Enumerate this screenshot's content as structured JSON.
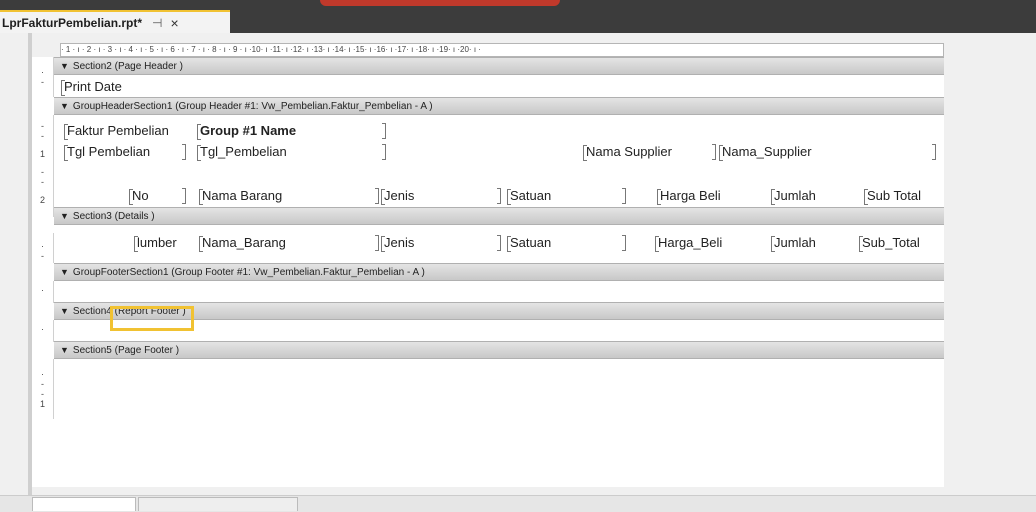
{
  "tab": {
    "title": "LprFakturPembelian.rpt*",
    "pin": "⊣",
    "close": "×"
  },
  "ruler": "· 1 · ı · 2 · ı · 3 · ı · 4 · ı · 5 · ı · 6 · ı · 7 · ı · 8 · ı · 9 · ı ·10· ı ·11· ı ·12· ı ·13· ı ·14· ı ·15· ı ·16· ı ·17· ı ·18· ı ·19· ı ·20· ı ·",
  "sections": {
    "page_header": "Section2 (Page Header )",
    "group_header": "GroupHeaderSection1 (Group Header #1: Vw_Pembelian.Faktur_Pembelian - A )",
    "details": "Section3 (Details )",
    "group_footer": "GroupFooterSection1 (Group Footer #1: Vw_Pembelian.Faktur_Pembelian - A )",
    "report_footer": "Section4 (Report Footer )",
    "page_footer": "Section5 (Page Footer )"
  },
  "fields": {
    "print_date": "Print Date",
    "faktur_label": "Faktur Pembelian",
    "group_name": "Group #1 Name",
    "tgl_label": "Tgl Pembelian",
    "tgl_value": "Tgl_Pembelian",
    "supplier_label": "Nama Supplier",
    "supplier_value": "Nama_Supplier",
    "col_no": "No",
    "col_nama": "Nama Barang",
    "col_jenis": "Jenis",
    "col_satuan": "Satuan",
    "col_harga": "Harga Beli",
    "col_jumlah": "Jumlah",
    "col_subtotal": "Sub Total",
    "d_nomor": "lumber",
    "d_nama": "Nama_Barang",
    "d_jenis": "Jenis",
    "d_satuan": "Satuan",
    "d_harga": "Harga_Beli",
    "d_jumlah": "Jumlah",
    "d_subtotal": "Sub_Total"
  },
  "vruler_marks": {
    "a": "·",
    "b": "-",
    "c": "1",
    "d": "2"
  }
}
